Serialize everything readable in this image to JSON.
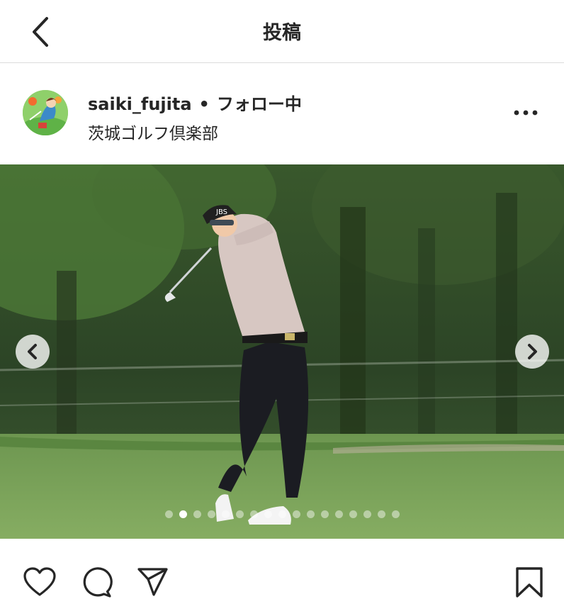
{
  "header": {
    "title": "投稿",
    "back_icon": "chevron-left-icon"
  },
  "post": {
    "username": "saiki_fujita",
    "separator": "•",
    "follow_status": "フォロー中",
    "location": "茨城ゴルフ倶楽部",
    "more_icon": "more-horizontal-icon",
    "image": {
      "cap_text": "JBS",
      "carousel": {
        "total": 17,
        "current": 2
      }
    }
  },
  "actions": {
    "like_icon": "heart-icon",
    "comment_icon": "comment-icon",
    "share_icon": "paper-plane-icon",
    "save_icon": "bookmark-icon"
  },
  "colors": {
    "text": "#262626",
    "divider": "#dbdbdb",
    "dot_active": "#ffffff",
    "fairway": "#7aa15a"
  }
}
